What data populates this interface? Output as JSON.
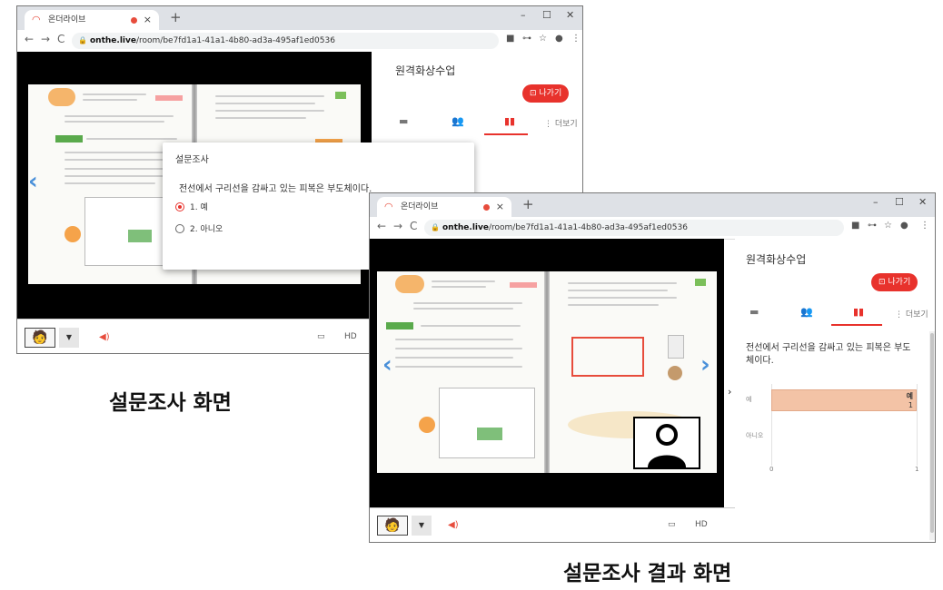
{
  "browser": {
    "tab_title": "온더라이브",
    "url_host": "onthe.live",
    "url_path": "/room/be7fd1a1-41a1-4b80-ad3a-495af1ed0536",
    "new_tab": "+",
    "close_tab": "×",
    "win_min": "–",
    "win_max": "☐",
    "win_close": "✕",
    "back": "←",
    "forward": "→",
    "reload": "C",
    "toolbar_icons": [
      "■",
      "⊶",
      "☆",
      "●",
      "⋮"
    ]
  },
  "panel": {
    "title": "원격화상수업",
    "exit_label": "⊡ 나가기",
    "more_label": "⋮ 더보기"
  },
  "survey": {
    "title": "설문조사",
    "question": "전선에서 구리선을 감싸고 있는 피복은 부도체이다.",
    "options": [
      "1. 예",
      "2. 아니오"
    ],
    "selected_index": 0
  },
  "results": {
    "question": "전선에서 구리선을 감싸고 있는 피복은 부도체이다.",
    "chart_data": {
      "type": "bar",
      "categories": [
        "예",
        "아니오"
      ],
      "values": [
        1,
        0
      ],
      "xlim": [
        0,
        1
      ],
      "ticks": [
        "0",
        "1"
      ]
    }
  },
  "captions": {
    "survey_screen": "설문조사 화면",
    "result_screen": "설문조사 결과 화면"
  },
  "colors": {
    "accent": "#e8322c",
    "bar": "#f3c3a6"
  }
}
